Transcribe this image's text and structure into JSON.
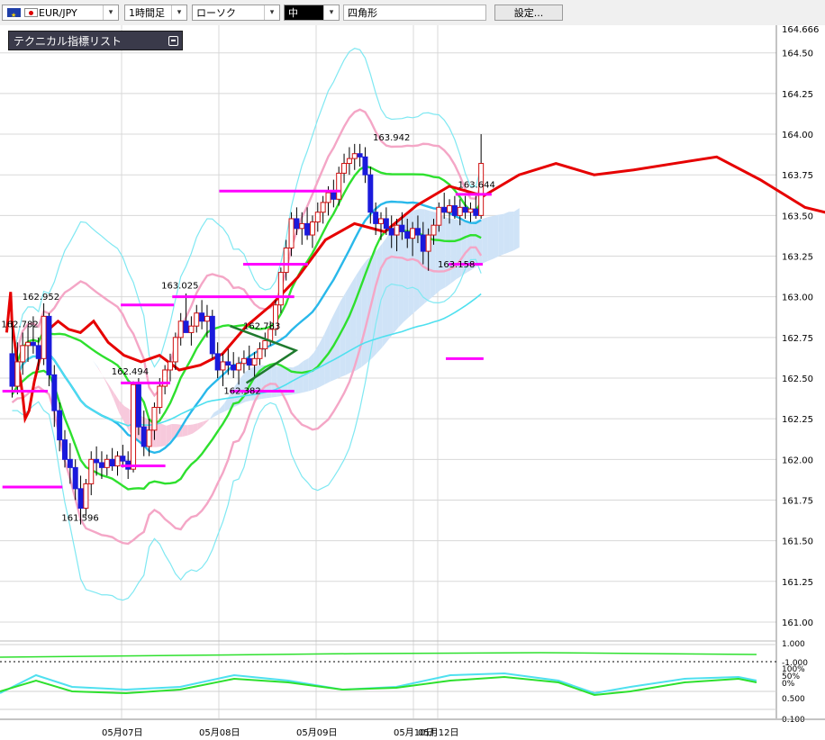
{
  "toolbar": {
    "symbol": "EUR/JPY",
    "timeframe": "1時間足",
    "chart_type": "ローソク",
    "line_size": "中",
    "drawing_tool": "四角形",
    "settings": "設定..."
  },
  "indicator_panel": {
    "title": "テクニカル指標リスト"
  },
  "colors": {
    "up_candle": "#ffffff",
    "down_candle": "#1a1adc",
    "wick": "#000000",
    "ichimoku_cloud": "#cfe3f7",
    "ichimoku_cloud_neg": "#f7c9dc",
    "bb_sigma1": "#2ee02e",
    "bb_sigma2": "#f4a6c6",
    "bb_sigma3": "#7fe8f2",
    "sma": "#29b8ea",
    "long_ma": "#4fe0ef",
    "chikou": "#e60000",
    "sr_lines": "#ff00ff",
    "triangle": "#1f7a2e"
  },
  "chart_data": {
    "type": "candlestick",
    "symbol": "EUR/JPY",
    "timeframe": "1時間足",
    "ylim": [
      160.95,
      164.67
    ],
    "yticks": [
      "164.666",
      "164.50",
      "164.25",
      "164.00",
      "163.75",
      "163.50",
      "163.25",
      "163.00",
      "162.75",
      "162.50",
      "162.25",
      "162.00",
      "161.75",
      "161.50",
      "161.25",
      "161.00"
    ],
    "xticks": [
      "05月07日",
      "05月08日",
      "05月09日",
      "05月10日",
      "05月12日"
    ],
    "xtick_hours": [
      30,
      54,
      78,
      102,
      108
    ],
    "candles": [
      [
        162.65,
        162.85,
        162.38,
        162.45
      ],
      [
        162.45,
        162.72,
        162.4,
        162.6
      ],
      [
        162.6,
        162.78,
        162.52,
        162.7
      ],
      [
        162.7,
        162.82,
        162.6,
        162.72
      ],
      [
        162.72,
        162.88,
        162.65,
        162.7
      ],
      [
        162.7,
        162.75,
        162.55,
        162.62
      ],
      [
        162.62,
        162.96,
        162.58,
        162.88
      ],
      [
        162.88,
        162.9,
        162.45,
        162.52
      ],
      [
        162.52,
        162.58,
        162.2,
        162.3
      ],
      [
        162.3,
        162.35,
        162.05,
        162.12
      ],
      [
        162.12,
        162.18,
        161.95,
        162.0
      ],
      [
        162.0,
        162.1,
        161.85,
        161.95
      ],
      [
        161.95,
        162.0,
        161.75,
        161.82
      ],
      [
        161.82,
        161.9,
        161.6,
        161.7
      ],
      [
        161.7,
        161.88,
        161.65,
        161.85
      ],
      [
        161.85,
        162.05,
        161.78,
        162.0
      ],
      [
        162.0,
        162.08,
        161.9,
        161.98
      ],
      [
        161.98,
        162.05,
        161.88,
        161.95
      ],
      [
        161.95,
        162.03,
        161.9,
        162.0
      ],
      [
        162.0,
        162.07,
        161.93,
        161.96
      ],
      [
        161.96,
        162.05,
        161.9,
        162.02
      ],
      [
        162.02,
        162.09,
        161.95,
        161.99
      ],
      [
        161.99,
        162.05,
        161.88,
        161.94
      ],
      [
        161.94,
        162.48,
        161.92,
        162.46
      ],
      [
        162.46,
        162.5,
        162.15,
        162.2
      ],
      [
        162.2,
        162.3,
        162.02,
        162.08
      ],
      [
        162.08,
        162.25,
        162.02,
        162.18
      ],
      [
        162.18,
        162.35,
        162.12,
        162.32
      ],
      [
        162.32,
        162.5,
        162.28,
        162.45
      ],
      [
        162.45,
        162.58,
        162.4,
        162.55
      ],
      [
        162.55,
        162.65,
        162.48,
        162.6
      ],
      [
        162.6,
        162.78,
        162.55,
        162.75
      ],
      [
        162.75,
        162.9,
        162.7,
        162.85
      ],
      [
        162.85,
        163.02,
        162.8,
        162.78
      ],
      [
        162.78,
        162.88,
        162.7,
        162.82
      ],
      [
        162.82,
        162.95,
        162.78,
        162.9
      ],
      [
        162.9,
        162.98,
        162.8,
        162.85
      ],
      [
        162.85,
        162.95,
        162.75,
        162.88
      ],
      [
        162.88,
        162.92,
        162.62,
        162.65
      ],
      [
        162.65,
        162.72,
        162.5,
        162.55
      ],
      [
        162.55,
        162.65,
        162.45,
        162.6
      ],
      [
        162.6,
        162.68,
        162.52,
        162.58
      ],
      [
        162.58,
        162.66,
        162.5,
        162.55
      ],
      [
        162.55,
        162.63,
        162.46,
        162.59
      ],
      [
        162.59,
        162.67,
        162.53,
        162.62
      ],
      [
        162.62,
        162.7,
        162.55,
        162.58
      ],
      [
        162.58,
        162.66,
        162.5,
        162.62
      ],
      [
        162.62,
        162.72,
        162.58,
        162.68
      ],
      [
        162.68,
        162.78,
        162.63,
        162.73
      ],
      [
        162.73,
        162.85,
        162.7,
        162.8
      ],
      [
        162.8,
        162.98,
        162.76,
        162.95
      ],
      [
        162.95,
        163.18,
        162.9,
        163.15
      ],
      [
        163.15,
        163.35,
        163.1,
        163.3
      ],
      [
        163.3,
        163.52,
        163.25,
        163.48
      ],
      [
        163.48,
        163.55,
        163.38,
        163.42
      ],
      [
        163.42,
        163.52,
        163.32,
        163.45
      ],
      [
        163.45,
        163.55,
        163.35,
        163.38
      ],
      [
        163.38,
        163.5,
        163.3,
        163.46
      ],
      [
        163.46,
        163.58,
        163.4,
        163.52
      ],
      [
        163.52,
        163.62,
        163.45,
        163.58
      ],
      [
        163.58,
        163.68,
        163.5,
        163.64
      ],
      [
        163.64,
        163.72,
        163.55,
        163.6
      ],
      [
        163.6,
        163.8,
        163.56,
        163.76
      ],
      [
        163.76,
        163.88,
        163.7,
        163.82
      ],
      [
        163.82,
        163.92,
        163.75,
        163.85
      ],
      [
        163.85,
        163.94,
        163.78,
        163.88
      ],
      [
        163.88,
        163.94,
        163.8,
        163.86
      ],
      [
        163.86,
        163.92,
        163.7,
        163.75
      ],
      [
        163.75,
        163.8,
        163.45,
        163.52
      ],
      [
        163.52,
        163.58,
        163.38,
        163.45
      ],
      [
        163.45,
        163.52,
        163.35,
        163.48
      ],
      [
        163.48,
        163.55,
        163.38,
        163.42
      ],
      [
        163.42,
        163.5,
        163.3,
        163.38
      ],
      [
        163.38,
        163.48,
        163.28,
        163.44
      ],
      [
        163.44,
        163.52,
        163.35,
        163.4
      ],
      [
        163.4,
        163.48,
        163.3,
        163.36
      ],
      [
        163.36,
        163.46,
        163.25,
        163.42
      ],
      [
        163.42,
        163.5,
        163.33,
        163.38
      ],
      [
        163.38,
        163.46,
        163.2,
        163.28
      ],
      [
        163.28,
        163.42,
        163.16,
        163.38
      ],
      [
        163.38,
        163.48,
        163.32,
        163.44
      ],
      [
        163.44,
        163.58,
        163.4,
        163.55
      ],
      [
        163.55,
        163.64,
        163.48,
        163.52
      ],
      [
        163.52,
        163.6,
        163.45,
        163.56
      ],
      [
        163.56,
        163.62,
        163.48,
        163.5
      ],
      [
        163.5,
        163.6,
        163.44,
        163.55
      ],
      [
        163.55,
        163.62,
        163.48,
        163.52
      ],
      [
        163.52,
        163.58,
        163.46,
        163.54
      ],
      [
        163.54,
        163.62,
        163.48,
        163.5
      ],
      [
        163.5,
        164.0,
        163.48,
        163.82
      ]
    ],
    "xtrace": [
      "chikou_span",
      [
        1,
        162.78
      ],
      [
        1,
        162.95
      ],
      [
        0.5,
        163.03
      ],
      [
        0.5,
        162.85
      ],
      [
        1,
        162.72
      ],
      [
        1,
        162.6
      ],
      [
        1,
        162.52
      ],
      [
        1,
        162.4
      ],
      [
        1,
        162.25
      ],
      [
        1.5,
        162.3
      ],
      [
        2,
        162.48
      ],
      [
        2.5,
        162.65
      ],
      [
        3,
        162.8
      ],
      [
        3.5,
        162.85
      ],
      [
        4,
        162.8
      ],
      [
        4.5,
        162.78
      ],
      [
        5,
        162.85
      ],
      [
        5.5,
        162.72
      ],
      [
        6,
        162.64
      ],
      [
        6.5,
        162.6
      ],
      [
        7,
        162.64
      ],
      [
        7.5,
        162.55
      ],
      [
        8,
        162.58
      ],
      [
        8.5,
        162.65
      ],
      [
        9,
        162.82
      ],
      [
        9.5,
        162.95
      ],
      [
        10,
        163.12
      ],
      [
        10.5,
        163.35
      ],
      [
        11,
        163.45
      ],
      [
        11.5,
        163.4
      ],
      [
        12,
        163.56
      ],
      [
        12.5,
        163.68
      ],
      [
        13,
        163.62
      ],
      [
        13.5,
        163.75
      ],
      [
        14,
        163.82
      ],
      [
        14.5,
        163.75
      ],
      [
        15,
        163.78
      ],
      [
        15.5,
        163.82
      ],
      [
        16,
        163.86
      ],
      [
        16.5,
        163.72
      ],
      [
        17,
        163.55
      ],
      [
        17.5,
        163.48
      ],
      [
        18,
        163.42
      ],
      [
        18.5,
        163.45
      ],
      [
        19,
        163.38
      ],
      [
        19.5,
        163.44
      ],
      [
        20,
        163.5
      ],
      [
        20.5,
        163.55
      ],
      [
        21,
        163.42
      ],
      [
        21.5,
        163.46
      ]
    ],
    "sr_levels": [
      {
        "y": 163.65,
        "from_hour": 54.1,
        "to_hour": 84.0
      },
      {
        "y": 163.2,
        "from_hour": 60.0,
        "to_hour": 76.0
      },
      {
        "y": 163.0,
        "from_hour": 42.5,
        "to_hour": 72.6
      },
      {
        "y": 162.95,
        "from_hour": 29.8,
        "to_hour": 42.9
      },
      {
        "y": 162.47,
        "from_hour": 29.8,
        "to_hour": 42.0
      },
      {
        "y": 162.42,
        "from_hour": 0.6,
        "to_hour": 11.8
      },
      {
        "y": 162.42,
        "from_hour": 56.7,
        "to_hour": 72.6
      },
      {
        "y": 161.96,
        "from_hour": 29.8,
        "to_hour": 40.8
      },
      {
        "y": 161.83,
        "from_hour": 0.6,
        "to_hour": 15.4
      },
      {
        "y": 162.62,
        "from_hour": 110.0,
        "to_hour": 119.3
      },
      {
        "y": 163.2,
        "from_hour": 110.7,
        "to_hour": 119.1
      },
      {
        "y": 163.63,
        "from_hour": 112.4,
        "to_hour": 121.3
      }
    ],
    "labels": [
      {
        "text": "162.782",
        "hour": 0.3,
        "y": 162.79
      },
      {
        "text": "162.952",
        "hour": 5.5,
        "y": 162.96
      },
      {
        "text": "161.596",
        "hour": 15.2,
        "y": 161.6
      },
      {
        "text": "162.494",
        "hour": 27.5,
        "y": 162.5
      },
      {
        "text": "163.025",
        "hour": 39.8,
        "y": 163.03
      },
      {
        "text": "162.783",
        "hour": 60.0,
        "y": 162.78
      },
      {
        "text": "162.382",
        "hour": 55.2,
        "y": 162.38
      },
      {
        "text": "163.942",
        "hour": 92.0,
        "y": 163.94
      },
      {
        "text": "163.644",
        "hour": 113.0,
        "y": 163.65
      },
      {
        "text": "163.158",
        "hour": 108.0,
        "y": 163.16
      }
    ],
    "triangle": {
      "p1": {
        "hour": 56.8,
        "y": 162.82
      },
      "p2": {
        "hour": 73.0,
        "y": 162.67
      },
      "p3": {
        "hour": 60.8,
        "y": 162.47
      }
    },
    "sub_axis": [
      "1.000",
      "-1.000",
      "100%",
      "50%",
      "0%",
      "0.500",
      "0.100"
    ]
  }
}
